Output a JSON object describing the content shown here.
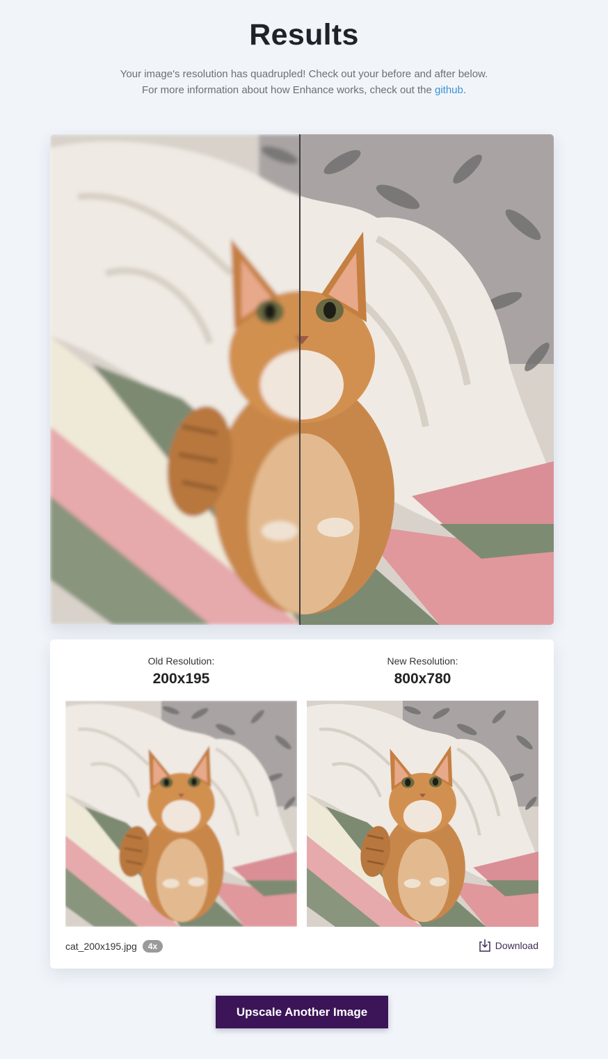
{
  "header": {
    "title": "Results",
    "line1": "Your image's resolution has quadrupled! Check out your before and after below.",
    "line2_prefix": "For more information about how Enhance works, check out the ",
    "link": "github",
    "line2_suffix": "."
  },
  "comparison": {
    "before_image": "cat-photo-low-res",
    "after_image": "cat-photo-enhanced",
    "divider_position": 0.5
  },
  "details": {
    "old": {
      "label": "Old Resolution:",
      "value": "200x195"
    },
    "new": {
      "label": "New Resolution:",
      "value": "800x780"
    },
    "filename": "cat_200x195.jpg",
    "scale_badge": "4x",
    "download_label": "Download",
    "download_icon": "download-icon"
  },
  "actions": {
    "upscale_again_label": "Upscale Another Image"
  },
  "colors": {
    "background": "#f1f5fa",
    "link": "#3a92d6",
    "button": "#3b1557",
    "badge": "#9a9a9a"
  }
}
